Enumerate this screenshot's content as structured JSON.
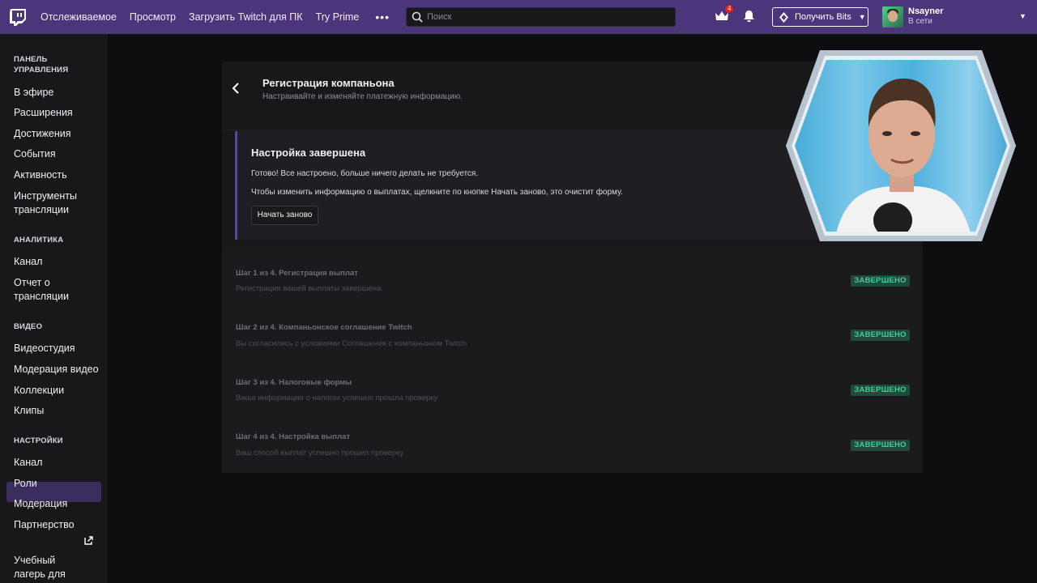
{
  "topnav": {
    "links": [
      "Отслеживаемое",
      "Просмотр",
      "Загрузить Twitch для ПК",
      "Try Prime"
    ],
    "more": "•••",
    "search_placeholder": "Поиск",
    "crown_count": "4",
    "bits_button": "Получить Bits",
    "user_name": "Nsayner",
    "user_status": "В сети"
  },
  "sidebar": {
    "sections": [
      {
        "title_lines": [
          "ПАНЕЛЬ",
          "УПРАВЛЕНИЯ"
        ],
        "items": [
          "В эфире",
          "Расширения",
          "Достижения",
          "События",
          "Активность",
          "Инструменты трансляции"
        ]
      },
      {
        "title": "АНАЛИТИКА",
        "items": [
          "Канал",
          "Отчет о трансляции"
        ]
      },
      {
        "title": "ВИДЕО",
        "items": [
          "Видеостудия",
          "Модерация видео",
          "Коллекции",
          "Клипы"
        ]
      },
      {
        "title": "НАСТРОЙКИ",
        "items": [
          "Канал",
          "Роли",
          "Модерация",
          "Партнерство"
        ]
      }
    ],
    "active_item": "Партнерство",
    "bottom_item_lines": [
      "Учебный",
      "лагерь для"
    ]
  },
  "panel": {
    "title": "Регистрация компаньона",
    "subtitle": "Настраивайте и изменяйте платежную информацию."
  },
  "done": {
    "title": "Настройка завершена",
    "text1": "Готово! Все настроено, больше ничего делать не требуется.",
    "text2": "Чтобы изменить информацию о выплатах, щелкните по кнопке Начать заново, это очистит форму.",
    "restart_button": "Начать заново"
  },
  "steps": [
    {
      "title": "Шаг 1 из 4. Регистрация выплат",
      "desc": "Регистрация вашей выплаты завершена.",
      "status": "ЗАВЕРШЕНО"
    },
    {
      "title": "Шаг 2 из 4. Компаньонское соглашение Twitch",
      "desc": "Вы согласились с условиями Соглашения с компаньоном Twitch.",
      "status": "ЗАВЕРШЕНО"
    },
    {
      "title": "Шаг 3 из 4. Налоговые формы",
      "desc": "Ваша информация о налогах успешно прошла проверку",
      "status": "ЗАВЕРШЕНО"
    },
    {
      "title": "Шаг 4 из 4. Настройка выплат",
      "desc": "Ваш способ выплат успешно прошел проверку",
      "status": "ЗАВЕРШЕНО"
    }
  ],
  "colors": {
    "nav_bg": "#4b367c",
    "accent": "#6441a5",
    "success_bg": "#1f4a3c",
    "success_text": "#3ecf95"
  }
}
